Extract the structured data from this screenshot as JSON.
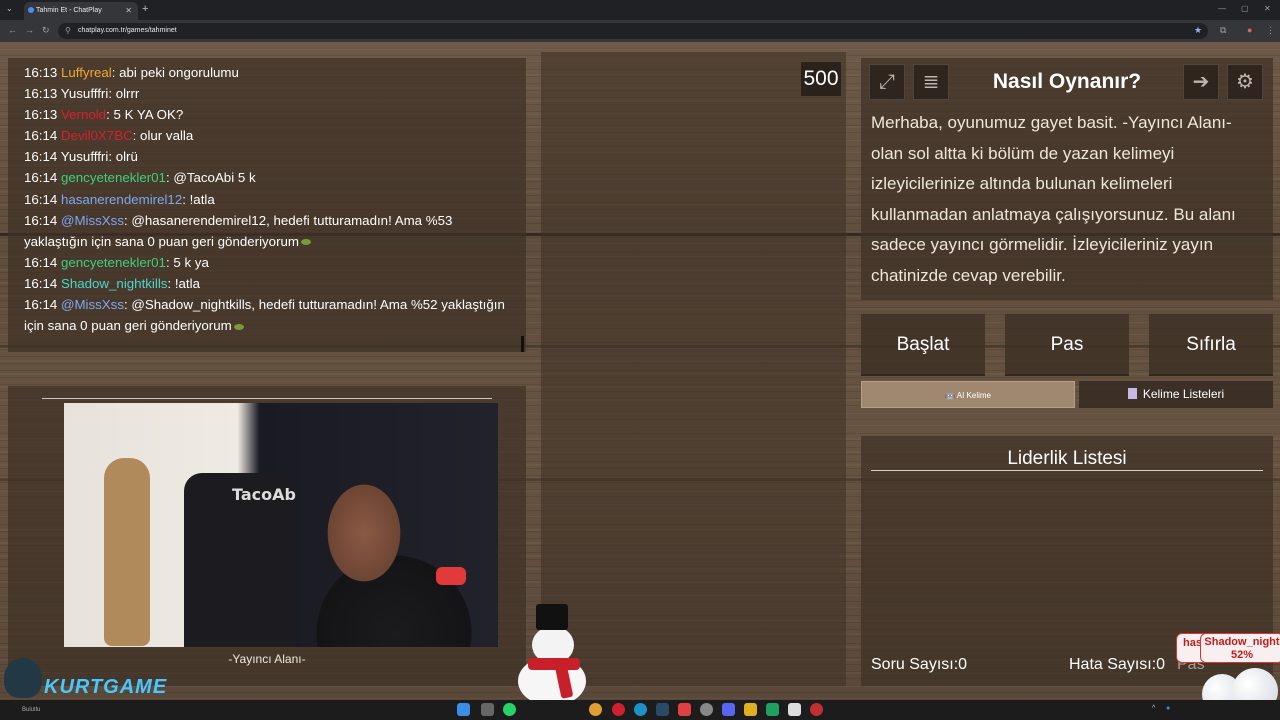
{
  "browser": {
    "tab_title": "Tahmin Et - ChatPlay",
    "url": "chatplay.com.tr/games/tahminet",
    "new_tab": "+"
  },
  "chat": {
    "messages": [
      {
        "time": "16:13",
        "user": "Luffyreal",
        "text": ": abi peki ongorulumu",
        "color": "#f0a830"
      },
      {
        "time": "16:13",
        "user": "Yusufffri",
        "text": ": olrrr",
        "color": "#ffffff"
      },
      {
        "time": "16:13",
        "user": "Vernold",
        "text": ": 5 K YA OK?",
        "color": "#d8202a"
      },
      {
        "time": "16:14",
        "user": "Devil0X7BC",
        "text": ": olur valla",
        "color": "#d8202a"
      },
      {
        "time": "16:14",
        "user": "Yusufffri",
        "text": ": olrü",
        "color": "#ffffff"
      },
      {
        "time": "16:14",
        "user": "gencyetenekler01",
        "text": ": @TacoAbi 5 k",
        "color": "#3fd07a"
      },
      {
        "time": "16:14",
        "user": "hasanerendemirel12",
        "text": ": !atla",
        "color": "#7ea8f0"
      },
      {
        "time": "16:14",
        "user": "@MissXss",
        "text": ": @hasanerendemirel12, hedefi tutturamadın! Ama %53 yaklaştığın için sana 0 puan geri gönderiyorum",
        "color": "#7ea8f0",
        "emoji": true
      },
      {
        "time": "16:14",
        "user": "gencyetenekler01",
        "text": ": 5 k ya",
        "color": "#3fd07a"
      },
      {
        "time": "16:14",
        "user": "Shadow_nightkills",
        "text": ": !atla",
        "color": "#4ad6c8"
      },
      {
        "time": "16:14",
        "user": "@MissXss",
        "text": ": @Shadow_nightkills, hedefi tutturamadın! Ama %52 yaklaştığın için sana 0 puan geri gönderiyorum",
        "color": "#7ea8f0",
        "emoji": true
      }
    ]
  },
  "streamer": {
    "label": "-Yayıncı Alanı-",
    "chair_text": "TacoAb"
  },
  "score": "500",
  "info": {
    "title": "Nasıl Oynanır?",
    "text": "Merhaba, oyunumuz gayet basit. -Yayıncı Alanı- olan sol altta ki bölüm de yazan kelimeyi izleyicilerinize altında bulunan kelimeleri kullanmadan anlatmaya çalışıyorsunuz. Bu alanı sadece yayıncı görmelidir. İzleyicileriniz yayın chatinizde cevap verebilir."
  },
  "buttons": {
    "start": "Başlat",
    "pass": "Pas",
    "reset": "Sıfırla"
  },
  "tabs": {
    "ai": "AI Kelime",
    "lists": "Kelime Listeleri"
  },
  "leaderboard": {
    "title": "Liderlik Listesi",
    "question_count": "Soru Sayısı:0",
    "error_count": "Hata Sayısı:0",
    "pass_count": "Pas"
  },
  "notification": {
    "name": "Shadow_night",
    "percent": "52%",
    "back_name": "has"
  },
  "overlay": {
    "logo_text": "KURTGAME",
    "small_text": "Bulutlu"
  }
}
